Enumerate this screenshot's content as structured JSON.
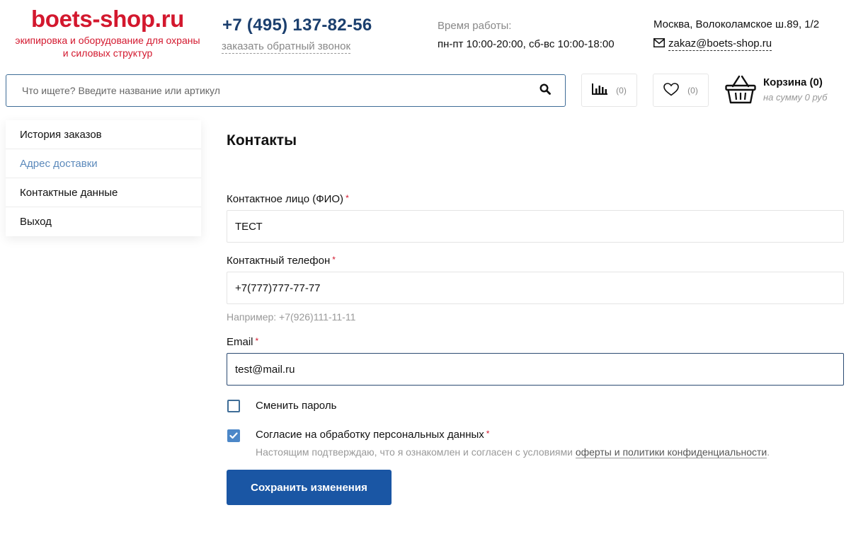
{
  "header": {
    "logo_name": "boets-shop.ru",
    "logo_tagline_1": "экипировка и оборудование для охраны",
    "logo_tagline_2": "и силовых структур",
    "phone": "+7 (495) 137-82-56",
    "callback_link": "заказать обратный звонок",
    "hours_label": "Время работы:",
    "hours": "пн-пт 10:00-20:00, сб-вс 10:00-18:00",
    "address": "Москва, Волоколамское ш.89, 1/2",
    "email": "zakaz@boets-shop.ru",
    "email_icon": "envelope-icon"
  },
  "search": {
    "placeholder": "Что ищете? Введите название или артикул",
    "icon": "search-icon"
  },
  "compare": {
    "icon": "bar-chart-icon",
    "count": "(0)"
  },
  "favorites": {
    "icon": "heart-icon",
    "count": "(0)"
  },
  "cart": {
    "icon": "basket-icon",
    "title": "Корзина (0)",
    "sum": "на сумму 0 руб"
  },
  "sidebar": {
    "items": [
      {
        "label": "История заказов",
        "active": false
      },
      {
        "label": "Адрес доставки",
        "active": true
      },
      {
        "label": "Контактные данные",
        "active": false
      },
      {
        "label": "Выход",
        "active": false
      }
    ]
  },
  "form": {
    "title": "Контакты",
    "required_mark": "*",
    "name_label": "Контактное лицо (ФИО)",
    "name_value": "ТЕСТ",
    "phone_label": "Контактный телефон",
    "phone_value": "+7(777)777-77-77",
    "phone_hint": "Например: +7(926)111-11-11",
    "email_label": "Email",
    "email_value": "test@mail.ru",
    "change_password_label": "Сменить пароль",
    "change_password_checked": false,
    "consent_label": "Согласие на обработку персональных данных",
    "consent_checked": true,
    "consent_text": "Настоящим подтверждаю, что я ознакомлен и согласен с условиями ",
    "consent_link": "оферты и политики конфиденциальности",
    "consent_end": ".",
    "save_button": "Сохранить изменения"
  },
  "colors": {
    "brand_red": "#d3182e",
    "phone_blue": "#1b3f6e",
    "button_blue": "#1a56a4",
    "active_link": "#5b89bb",
    "checkbox_blue": "#4c87c8"
  }
}
